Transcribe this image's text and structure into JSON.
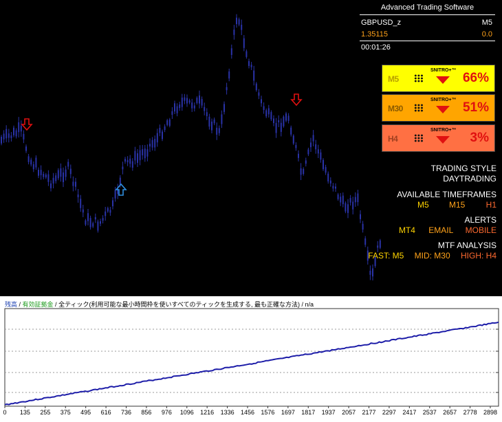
{
  "info": {
    "title": "Advanced Trading Software",
    "symbol": "GBPUSD_z",
    "timeframe": "M5",
    "price": "1.35115",
    "change": "0.0",
    "time": "00:01:26"
  },
  "signals": [
    {
      "tf": "M5",
      "brand": "SNITRO+™",
      "pct": "66%",
      "bg": "#ffff00",
      "tfColor": "#b8a000"
    },
    {
      "tf": "M30",
      "brand": "SNITRO+™",
      "pct": "51%",
      "bg": "#ffa500",
      "tfColor": "#8a5a00"
    },
    {
      "tf": "H4",
      "brand": "SNITRO+™",
      "pct": "3%",
      "bg": "#ff7043",
      "tfColor": "#a04020"
    }
  ],
  "panel": {
    "style_label": "TRADING STYLE",
    "style_value": "DAYTRADING",
    "tf_label": "AVAILABLE TIMEFRAMES",
    "tf_values": [
      "M5",
      "M15",
      "H1"
    ],
    "alerts_label": "ALERTS",
    "alerts_values": [
      "MT4",
      "EMAIL",
      "MOBILE"
    ],
    "mtf_label": "MTF ANALYSIS",
    "mtf_values": [
      "FAST: M5",
      "MID: M30",
      "HIGH: H4"
    ]
  },
  "colors": {
    "candle": "#2a33a8",
    "arrow_down": "#e01010",
    "arrow_up": "#2f8fe0",
    "equity_line": "#1c1ca8",
    "yellow": "#ffff00",
    "orange": "#ffa500",
    "red_orange": "#ff5020"
  },
  "equity": {
    "header_balance": "残高",
    "header_sep1": " / ",
    "header_equity": "有効証拠金",
    "header_sep2": " / ",
    "header_ticks": "全ティック(利用可能な最小時間枠を使いすべてのティックを生成する, 最も正確な方法)",
    "header_sep3": " / ",
    "header_na": "n/a",
    "x_ticks": [
      "0",
      "135",
      "255",
      "375",
      "495",
      "616",
      "736",
      "856",
      "976",
      "1096",
      "1216",
      "1336",
      "1456",
      "1576",
      "1697",
      "1817",
      "1937",
      "2057",
      "2177",
      "2297",
      "2417",
      "2537",
      "2657",
      "2778",
      "2898"
    ]
  }
}
